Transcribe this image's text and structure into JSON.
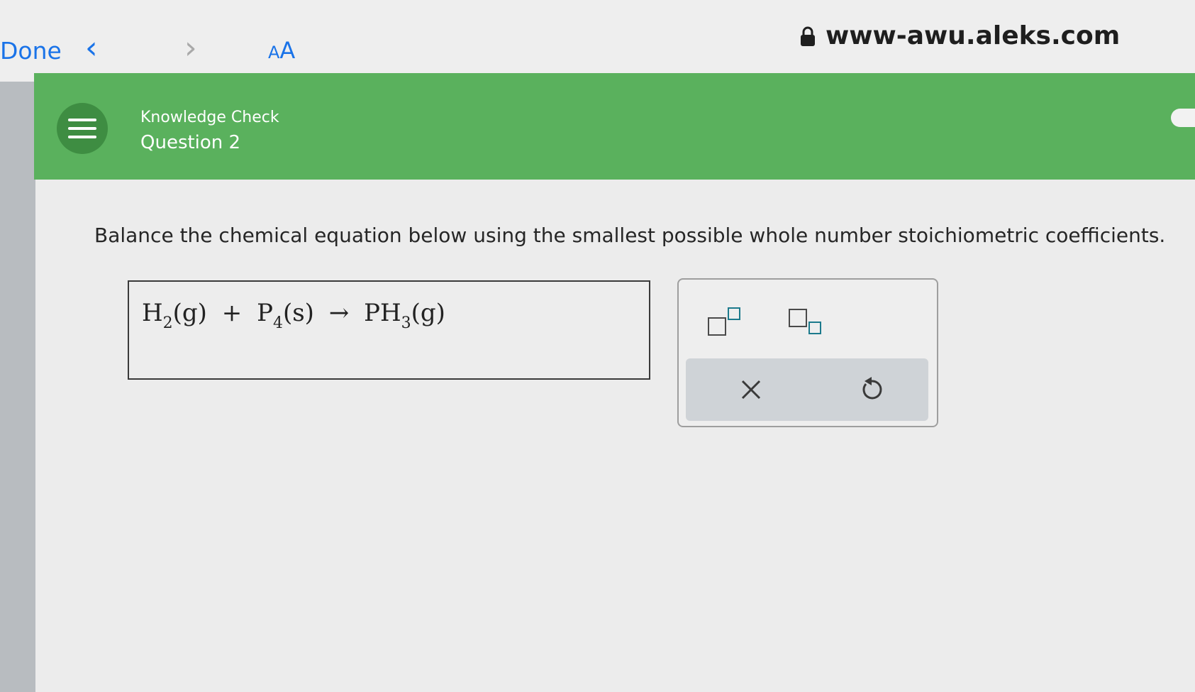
{
  "browser": {
    "done_label": "Done",
    "back_icon": "chevron-left-icon",
    "forward_icon": "chevron-right-icon",
    "text_size_small": "A",
    "text_size_large": "A",
    "url": "www-awu.aleks.com",
    "lock_icon": "lock-icon"
  },
  "header": {
    "menu_icon": "hamburger-menu-icon",
    "section": "Knowledge Check",
    "question_label": "Question 2",
    "color": "#5ab15d"
  },
  "question": {
    "prompt": "Balance the chemical equation below using the smallest possible whole number stoichiometric coefficients."
  },
  "equation": {
    "r1_symbol": "H",
    "r1_sub": "2",
    "r1_state": "(g)",
    "plus": "+",
    "r2_symbol": "P",
    "r2_sub": "4",
    "r2_state": "(s)",
    "arrow": "→",
    "p1_symbol": "PH",
    "p1_sub": "3",
    "p1_state": "(g)"
  },
  "palette": {
    "superscript_icon": "superscript-box-icon",
    "subscript_icon": "subscript-box-icon",
    "clear_icon": "close-icon",
    "undo_icon": "undo-icon"
  }
}
